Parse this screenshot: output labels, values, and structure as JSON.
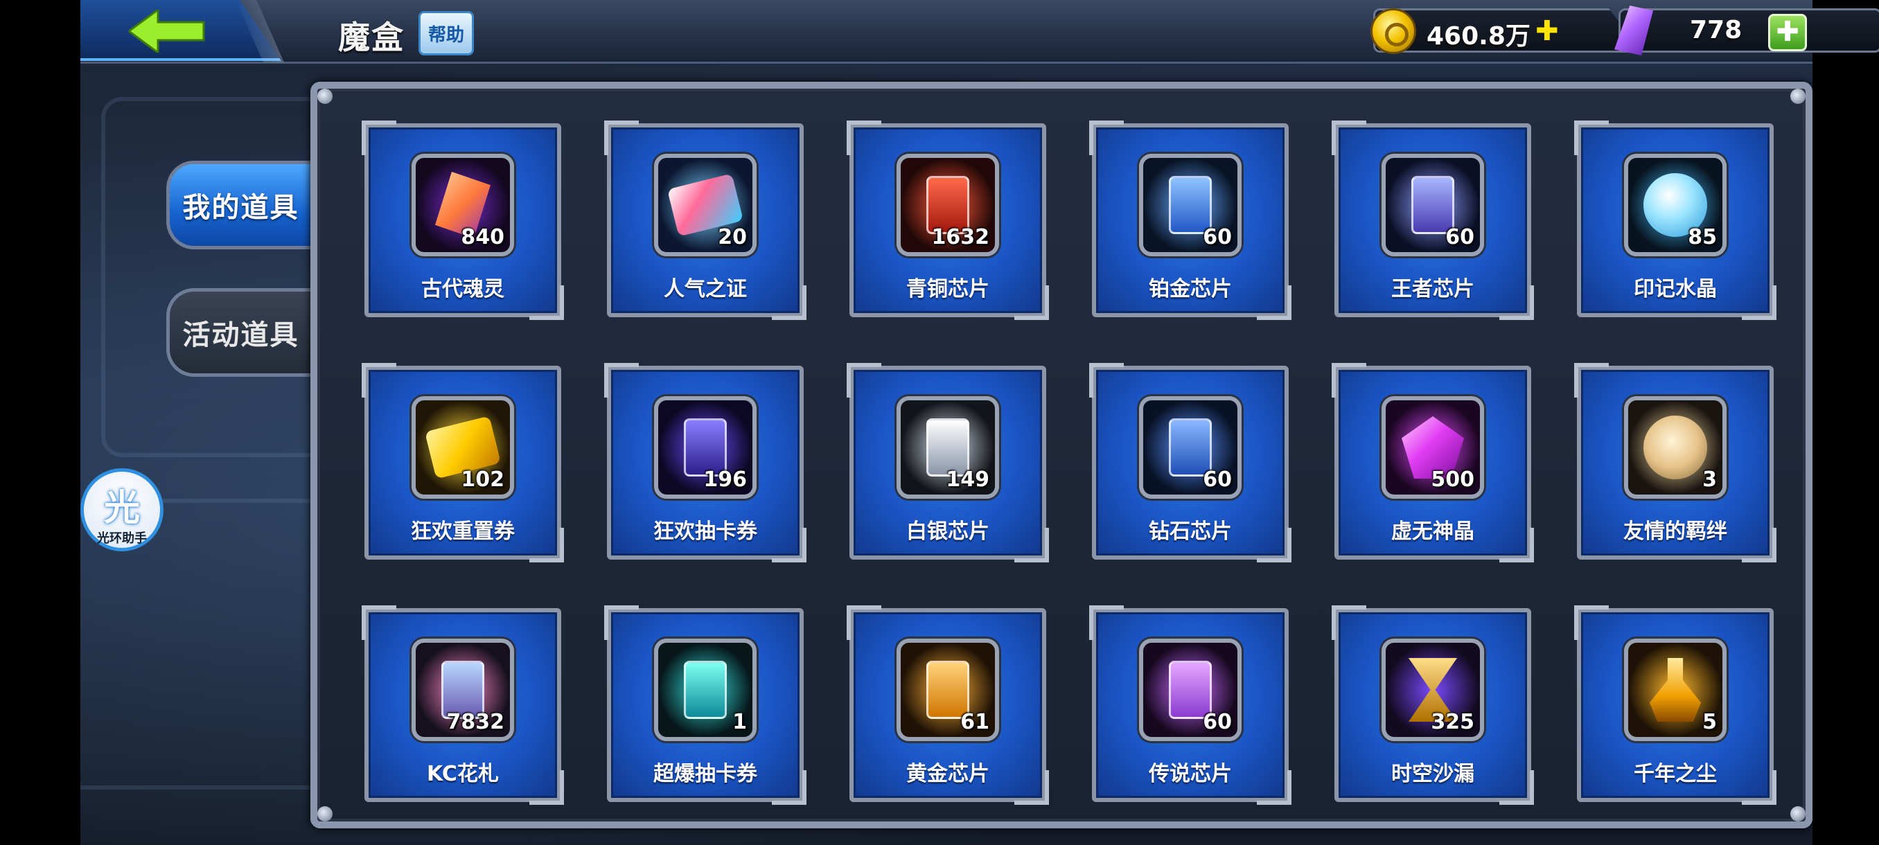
{
  "header": {
    "title": "魔盒",
    "help_label": "帮助",
    "gold": "460.8万",
    "gems": "778"
  },
  "tabs": [
    {
      "label": "我的道具",
      "active": true
    },
    {
      "label": "活动道具",
      "active": false
    }
  ],
  "assistant": {
    "glyph": "光",
    "label": "光环助手"
  },
  "items": [
    {
      "name": "古代魂灵",
      "count": "840",
      "icon": "soul-shard-icon"
    },
    {
      "name": "人气之证",
      "count": "20",
      "icon": "popularity-card-icon"
    },
    {
      "name": "青铜芯片",
      "count": "1632",
      "icon": "bronze-chip-icon"
    },
    {
      "name": "铂金芯片",
      "count": "60",
      "icon": "platinum-chip-icon"
    },
    {
      "name": "王者芯片",
      "count": "60",
      "icon": "king-chip-icon"
    },
    {
      "name": "印记水晶",
      "count": "85",
      "icon": "crystal-orb-icon"
    },
    {
      "name": "狂欢重置券",
      "count": "102",
      "icon": "reset-ticket-icon"
    },
    {
      "name": "狂欢抽卡券",
      "count": "196",
      "icon": "draw-ticket-icon"
    },
    {
      "name": "白银芯片",
      "count": "149",
      "icon": "silver-chip-icon"
    },
    {
      "name": "钻石芯片",
      "count": "60",
      "icon": "diamond-chip-icon"
    },
    {
      "name": "虚无神晶",
      "count": "500",
      "icon": "void-crystal-icon"
    },
    {
      "name": "友情的羁绊",
      "count": "3",
      "icon": "friendship-icon"
    },
    {
      "name": "KC花札",
      "count": "7832",
      "icon": "kc-card-icon"
    },
    {
      "name": "超爆抽卡券",
      "count": "1",
      "icon": "super-draw-ticket-icon"
    },
    {
      "name": "黄金芯片",
      "count": "61",
      "icon": "gold-chip-icon"
    },
    {
      "name": "传说芯片",
      "count": "60",
      "icon": "legend-chip-icon"
    },
    {
      "name": "时空沙漏",
      "count": "325",
      "icon": "hourglass-icon"
    },
    {
      "name": "千年之尘",
      "count": "5",
      "icon": "millennium-dust-icon"
    }
  ]
}
